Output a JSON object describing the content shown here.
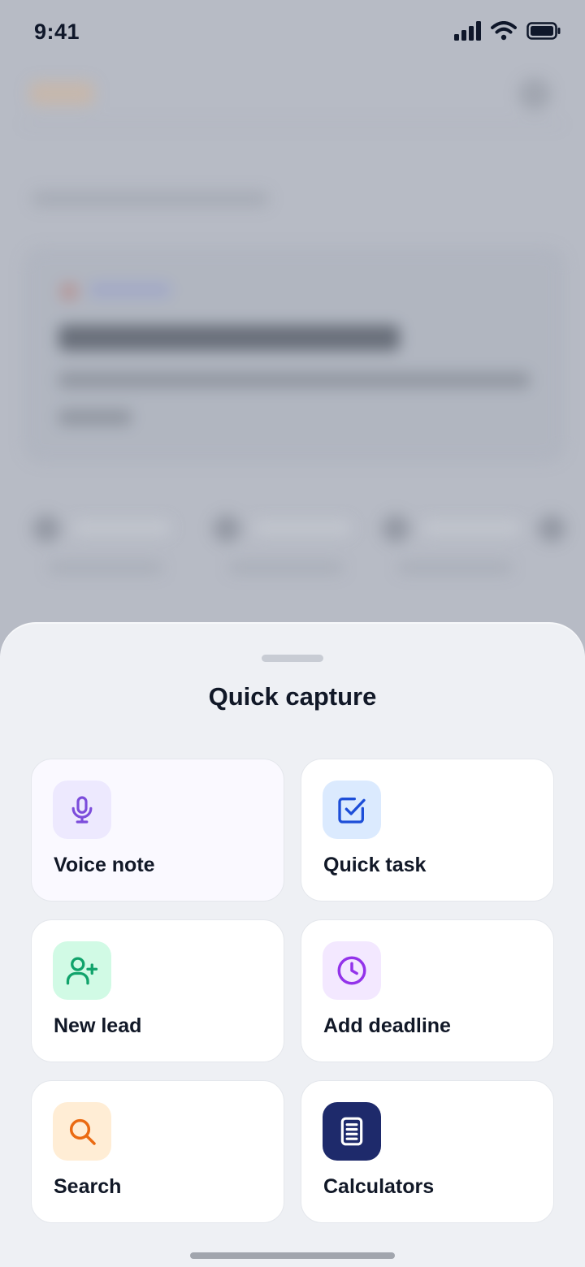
{
  "status_bar": {
    "time": "9:41",
    "icons": [
      "cellular-signal-icon",
      "wifi-icon",
      "battery-icon"
    ]
  },
  "sheet": {
    "title": "Quick capture",
    "actions": [
      {
        "id": "voice-note",
        "label": "Voice note",
        "icon": "microphone-icon",
        "icon_color": "#7c4ddb",
        "tile_bg": "#ede9fe"
      },
      {
        "id": "quick-task",
        "label": "Quick task",
        "icon": "checkbox-icon",
        "icon_color": "#1d4ed8",
        "tile_bg": "#dbeafe"
      },
      {
        "id": "new-lead",
        "label": "New lead",
        "icon": "user-plus-icon",
        "icon_color": "#10a36b",
        "tile_bg": "#d1fae5"
      },
      {
        "id": "add-deadline",
        "label": "Add deadline",
        "icon": "clock-icon",
        "icon_color": "#9333ea",
        "tile_bg": "#f3e8ff"
      },
      {
        "id": "search",
        "label": "Search",
        "icon": "search-icon",
        "icon_color": "#ea6a12",
        "tile_bg": "#ffedd5"
      },
      {
        "id": "calculators",
        "label": "Calculators",
        "icon": "calculator-icon",
        "icon_color": "#ffffff",
        "tile_bg": "#1e2a6b"
      }
    ]
  }
}
